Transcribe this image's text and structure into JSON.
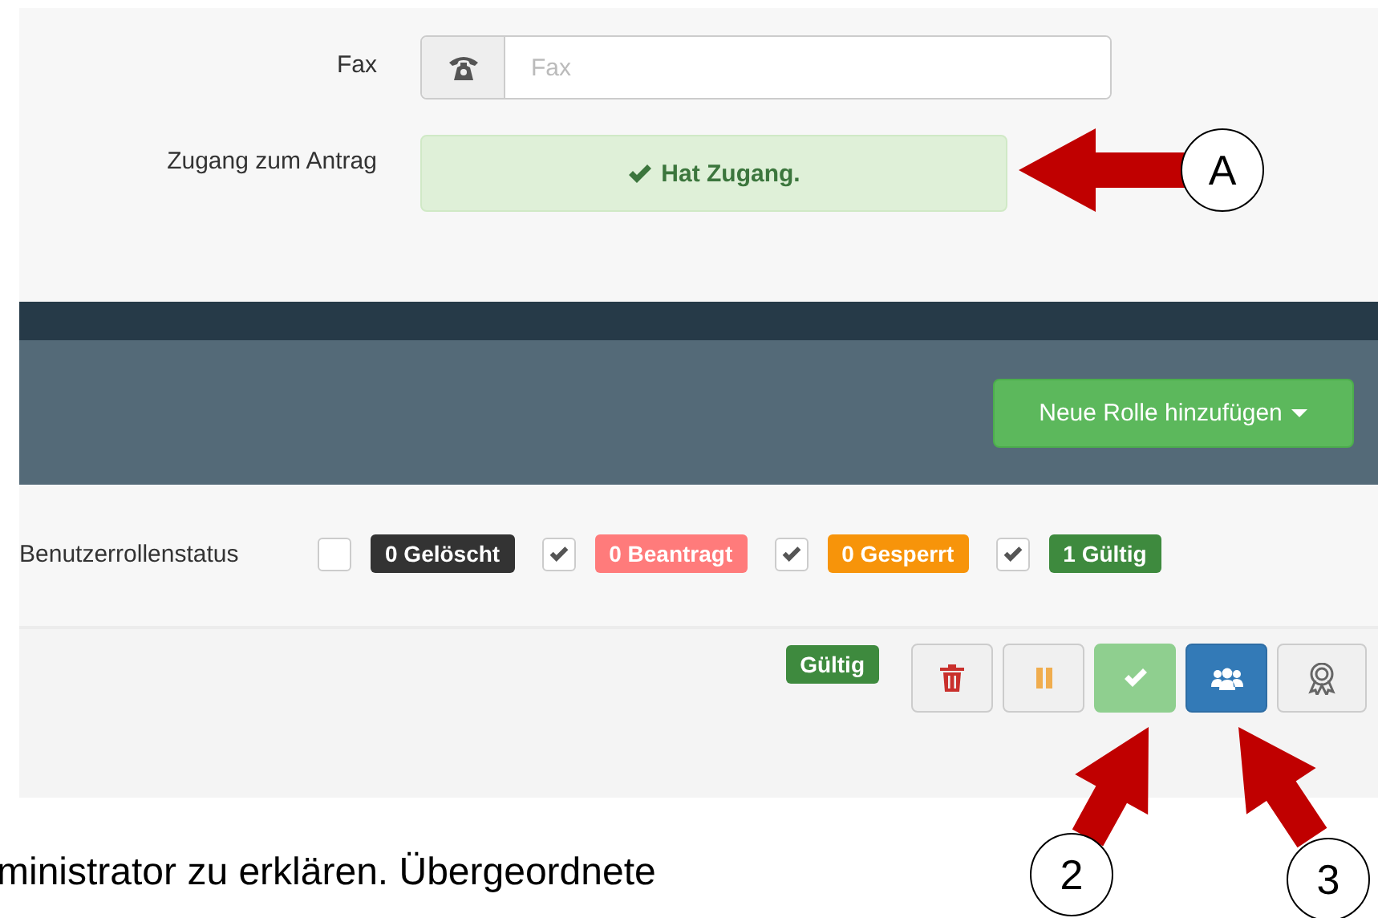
{
  "form": {
    "fields": [
      {
        "label": "Fax",
        "kind": "input",
        "placeholder": "Fax"
      },
      {
        "label": "Zugang zum Antrag",
        "kind": "alert",
        "value": "Hat Zugang."
      }
    ]
  },
  "toolbar": {
    "button": "Neue Rolle hinzufügen"
  },
  "status_filter": {
    "label": "Benutzerrollenstatus",
    "items": [
      {
        "text": "0 Gelöscht",
        "checked": false,
        "color": "#333333"
      },
      {
        "text": "0 Beantragt",
        "checked": true,
        "color": "#ff7b7b"
      },
      {
        "text": "0 Gesperrt",
        "checked": true,
        "color": "#f7940a"
      },
      {
        "text": "1 Gültig",
        "checked": true,
        "color": "#3e8a3e"
      }
    ]
  },
  "role_row": {
    "badge": "Gültig",
    "actions": [
      {
        "kind": "delete"
      },
      {
        "kind": "pause"
      },
      {
        "kind": "approve"
      },
      {
        "kind": "members"
      },
      {
        "kind": "award"
      }
    ]
  },
  "callouts": [
    "A",
    "2",
    "3"
  ],
  "document_text": [
    "ministrator zu erklären. Übergeordnete"
  ]
}
